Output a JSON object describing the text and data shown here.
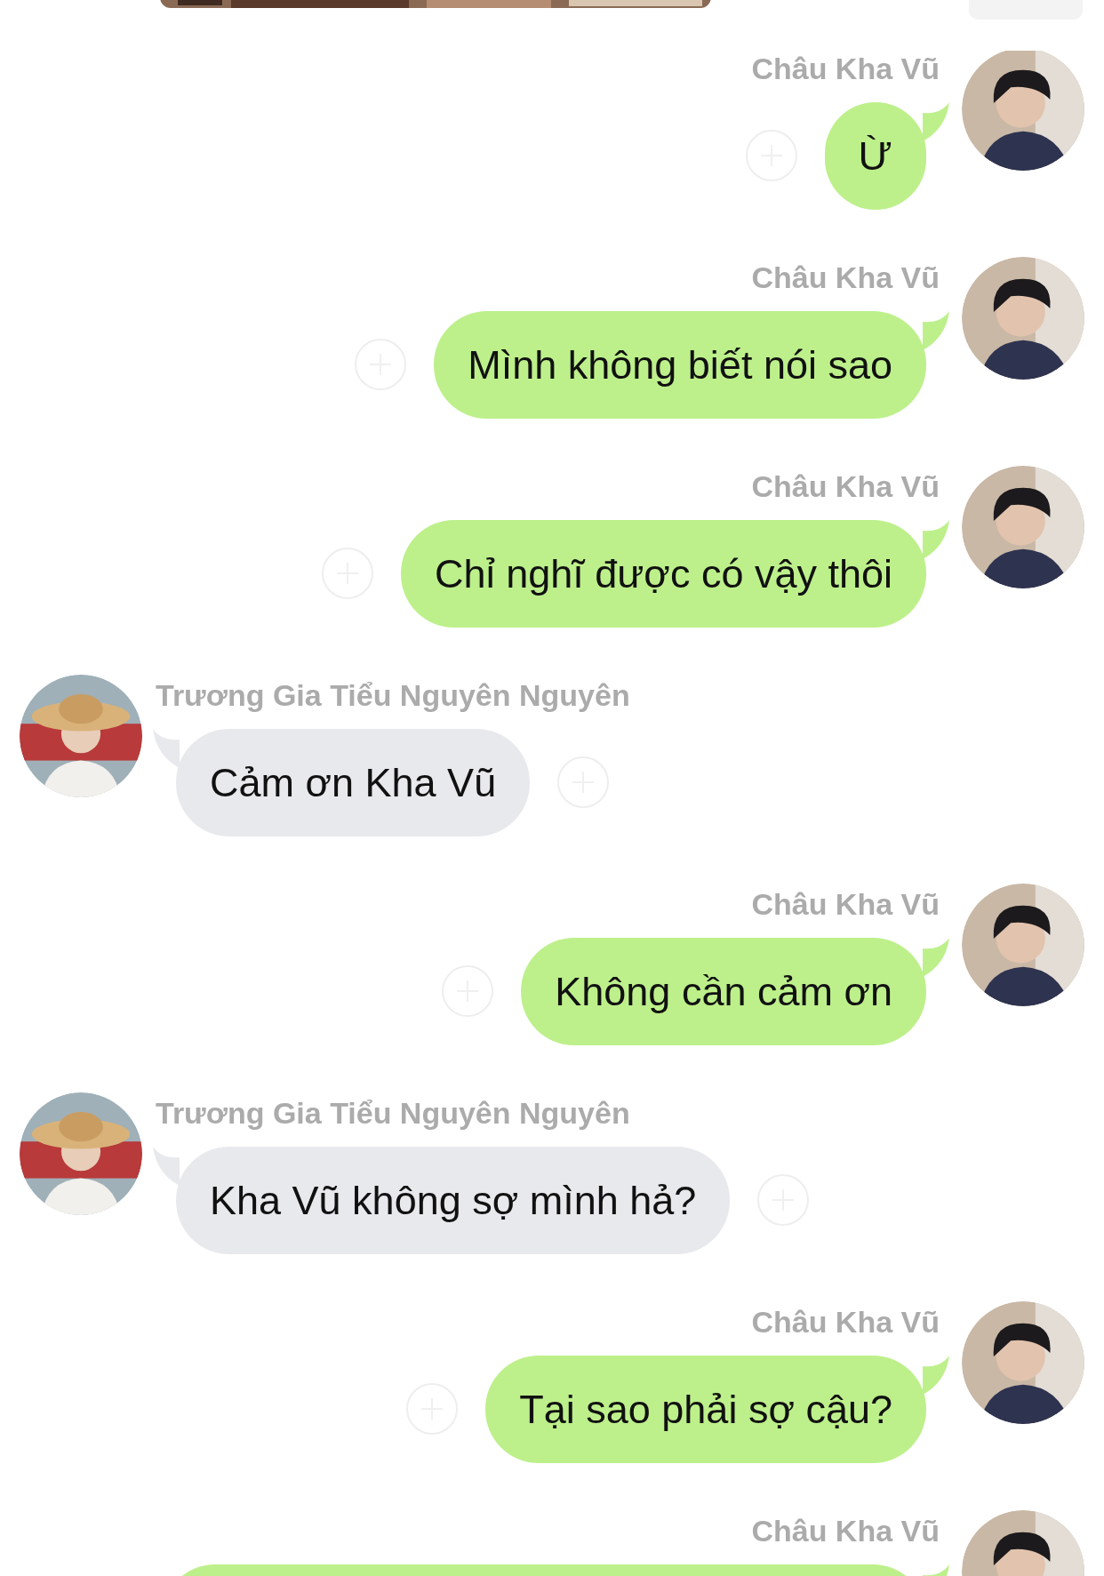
{
  "messages": [
    {
      "kind": "outgoing",
      "sender": "Châu Kha Vũ",
      "text": "Ừ"
    },
    {
      "kind": "outgoing",
      "sender": "Châu Kha Vũ",
      "text": "Mình không biết nói sao"
    },
    {
      "kind": "outgoing",
      "sender": "Châu Kha Vũ",
      "text": "Chỉ nghĩ được có vậy thôi"
    },
    {
      "kind": "incoming",
      "sender": "Trương Gia Tiểu Nguyên Nguyên",
      "text": "Cảm ơn Kha Vũ"
    },
    {
      "kind": "outgoing",
      "sender": "Châu Kha Vũ",
      "text": "Không cần cảm ơn"
    },
    {
      "kind": "incoming",
      "sender": "Trương Gia Tiểu Nguyên Nguyên",
      "text": "Kha Vũ không sợ mình hả?"
    },
    {
      "kind": "outgoing",
      "sender": "Châu Kha Vũ",
      "text": "Tại sao phải sợ cậu?"
    },
    {
      "kind": "outgoing",
      "sender": "Châu Kha Vũ"
    }
  ]
}
